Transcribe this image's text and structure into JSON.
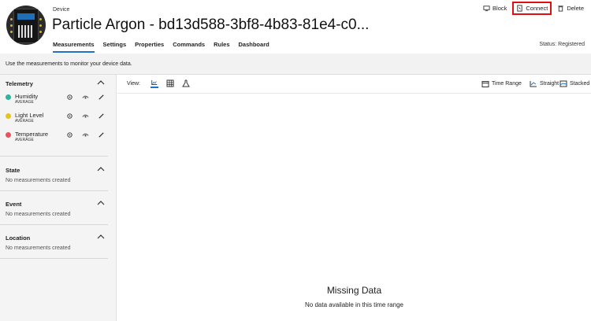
{
  "header": {
    "label": "Device",
    "title": "Particle Argon - bd13d588-3bf8-4b83-81e4-c0...",
    "status": "Status: Registered",
    "tabs": [
      {
        "label": "Measurements",
        "active": true
      },
      {
        "label": "Settings"
      },
      {
        "label": "Properties"
      },
      {
        "label": "Commands"
      },
      {
        "label": "Rules"
      },
      {
        "label": "Dashboard"
      }
    ],
    "actions": {
      "block": "Block",
      "connect": "Connect",
      "delete": "Delete"
    }
  },
  "hint": "Use the measurements to monitor your device data.",
  "sidebar": {
    "telemetry": {
      "title": "Telemetry",
      "items": [
        {
          "name": "Humidity",
          "aggregation": "AVERAGE",
          "color": "#2bb5a0"
        },
        {
          "name": "Light Level",
          "aggregation": "AVERAGE",
          "color": "#e8c31f"
        },
        {
          "name": "Temperature",
          "aggregation": "AVERAGE",
          "color": "#e8545a"
        }
      ]
    },
    "state": {
      "title": "State",
      "empty": "No measurements created"
    },
    "event": {
      "title": "Event",
      "empty": "No measurements created"
    },
    "location": {
      "title": "Location",
      "empty": "No measurements created"
    }
  },
  "main": {
    "view_label": "View:",
    "time_range": "Time Range",
    "straight": "Straight",
    "stacked": "Stacked",
    "missing_title": "Missing Data",
    "missing_sub": "No data available in this time range"
  },
  "colors": {
    "accent": "#1e73c8",
    "highlight": "#e01010"
  }
}
